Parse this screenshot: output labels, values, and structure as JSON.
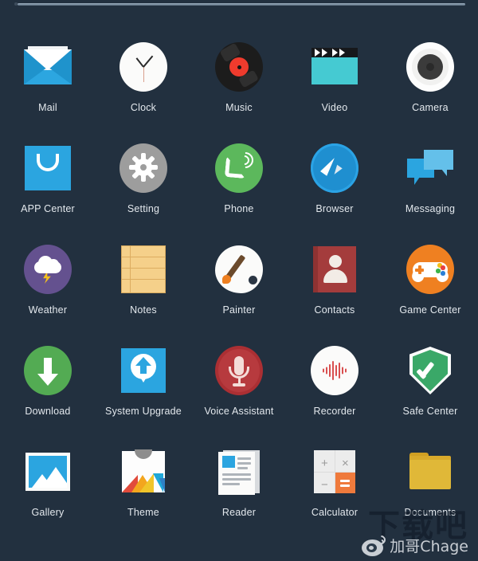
{
  "screen": {
    "background_color": "#22303f",
    "label_color": "#e3e8ed"
  },
  "topbar": {
    "divider_name": "scroll-indicator"
  },
  "apps": [
    {
      "label": "Mail",
      "icon": "mail-icon",
      "color": "#2ca6e0"
    },
    {
      "label": "Clock",
      "icon": "clock-icon",
      "color": "#fbfbfa"
    },
    {
      "label": "Music",
      "icon": "music-vinyl-icon",
      "color": "#1c1c1c"
    },
    {
      "label": "Video",
      "icon": "clapperboard-icon",
      "color": "#45cad2"
    },
    {
      "label": "Camera",
      "icon": "camera-icon",
      "color": "#fdfdfd"
    },
    {
      "label": "APP Center",
      "icon": "shopping-bag-icon",
      "color": "#2ba5e0"
    },
    {
      "label": "Setting",
      "icon": "gear-icon",
      "color": "#9d9d9d"
    },
    {
      "label": "Phone",
      "icon": "phone-handset-icon",
      "color": "#5cb85c"
    },
    {
      "label": "Browser",
      "icon": "compass-icon",
      "color": "#1f8fd0"
    },
    {
      "label": "Messaging",
      "icon": "speech-bubbles-icon",
      "color": "#2ba5e0"
    },
    {
      "label": "Weather",
      "icon": "cloud-lightning-icon",
      "color": "#64518f"
    },
    {
      "label": "Notes",
      "icon": "notepad-icon",
      "color": "#f5d08a"
    },
    {
      "label": "Painter",
      "icon": "palette-brush-icon",
      "color": "#fbfbfa"
    },
    {
      "label": "Contacts",
      "icon": "address-book-icon",
      "color": "#a43c3c"
    },
    {
      "label": "Game Center",
      "icon": "gamepad-icon",
      "color": "#ef8021"
    },
    {
      "label": "Download",
      "icon": "download-arrow-icon",
      "color": "#53ab53"
    },
    {
      "label": "System Upgrade",
      "icon": "upgrade-pin-icon",
      "color": "#2ba5e0"
    },
    {
      "label": "Voice Assistant",
      "icon": "microphone-icon",
      "color": "#ab2f33"
    },
    {
      "label": "Recorder",
      "icon": "waveform-icon",
      "color": "#d94f4f"
    },
    {
      "label": "Safe Center",
      "icon": "shield-check-icon",
      "color": "#3aa868"
    },
    {
      "label": "Gallery",
      "icon": "photo-mountain-icon",
      "color": "#2ba5e0"
    },
    {
      "label": "Theme",
      "icon": "tshirt-icon",
      "color": "#fdfdfd"
    },
    {
      "label": "Reader",
      "icon": "document-page-icon",
      "color": "#fbfbfa"
    },
    {
      "label": "Calculator",
      "icon": "calculator-icon",
      "color": "#ef7a3c"
    },
    {
      "label": "Documents",
      "icon": "folder-icon",
      "color": "#e0b838"
    }
  ],
  "calculator_keys": {
    "plus": "+",
    "times": "×",
    "minus": "−",
    "equals": "="
  },
  "watermark": {
    "site": "下载吧",
    "author": "加哥Chage",
    "logo": "weibo-eye-icon"
  }
}
